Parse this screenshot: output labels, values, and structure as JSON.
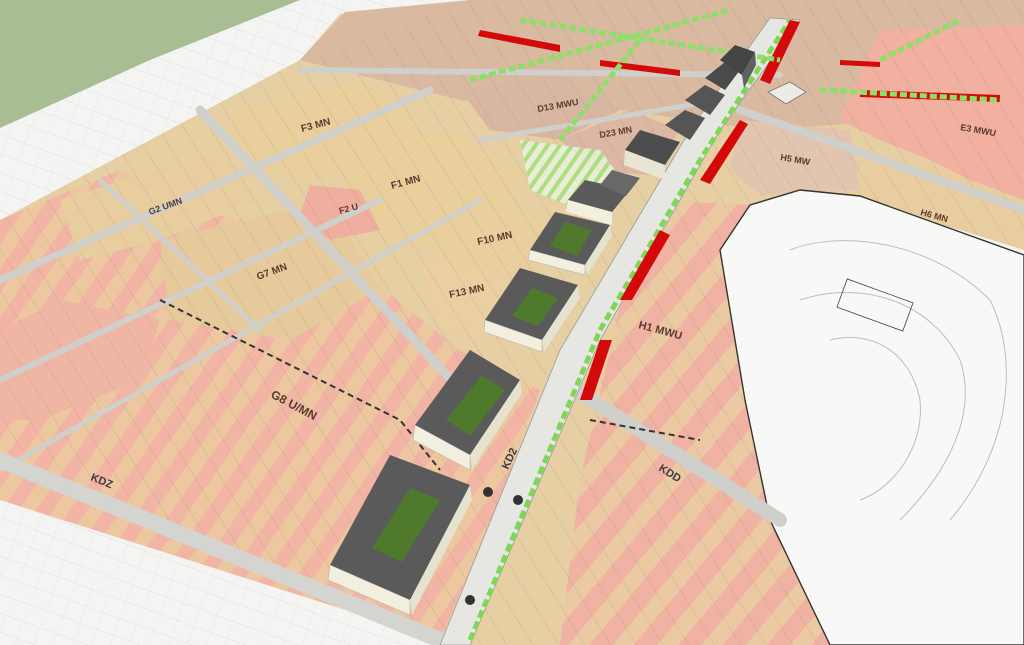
{
  "palette": {
    "grass": "#a9bd95",
    "basemap": "#f4f4f2",
    "residential_low": "#e8cfa0",
    "residential_mixed": "#f2b4a4",
    "service": "#d9b9a0",
    "road": "#d8d8d4",
    "green_strip": "#8ede6a",
    "red_strip": "#d40a0a",
    "building_roof": "#5a5a5a",
    "building_wall": "#f2efde",
    "courtyard": "#4f7a2c"
  },
  "zone_labels": {
    "g8": "G8 U/MN",
    "g7": "G7 MN",
    "f1": "F1 MN",
    "f3": "F3 MN",
    "f10": "F10 MN",
    "f13": "F13 MN",
    "d13": "D13 MWU",
    "d23": "D23 MN",
    "h1": "H1 MWU",
    "h5": "H5 MW",
    "h6": "H6 MN",
    "e3": "E3 MWU",
    "g2": "G2 UMN",
    "f2": "F2 U"
  },
  "road_labels": {
    "kdd": "KDD",
    "kd2": "KD2",
    "kdz": "KDZ"
  }
}
